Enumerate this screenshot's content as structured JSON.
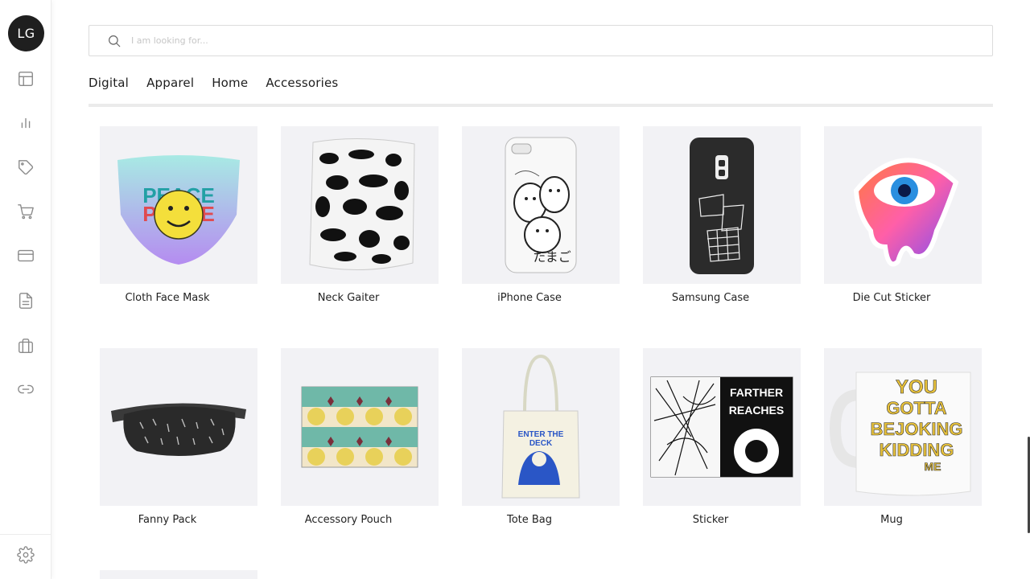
{
  "sidebar": {
    "avatar_initials": "LG",
    "items": [
      {
        "name": "layout-icon"
      },
      {
        "name": "chart-icon"
      },
      {
        "name": "tag-icon"
      },
      {
        "name": "cart-icon"
      },
      {
        "name": "card-icon"
      },
      {
        "name": "document-icon"
      },
      {
        "name": "briefcase-icon"
      },
      {
        "name": "link-icon"
      }
    ],
    "settings": {
      "name": "gear-icon"
    }
  },
  "search": {
    "placeholder": "I am looking for..."
  },
  "tabs": [
    {
      "label": "Digital"
    },
    {
      "label": "Apparel"
    },
    {
      "label": "Home"
    },
    {
      "label": "Accessories"
    }
  ],
  "products": [
    {
      "label": "Cloth Face Mask"
    },
    {
      "label": "Neck Gaiter"
    },
    {
      "label": "iPhone Case"
    },
    {
      "label": "Samsung Case"
    },
    {
      "label": "Die Cut Sticker"
    },
    {
      "label": "Fanny Pack"
    },
    {
      "label": "Accessory Pouch"
    },
    {
      "label": "Tote Bag"
    },
    {
      "label": "Sticker"
    },
    {
      "label": "Mug"
    }
  ],
  "colors": {
    "accent": "#1f1f1f",
    "thumb_bg": "#f2f2f5"
  }
}
